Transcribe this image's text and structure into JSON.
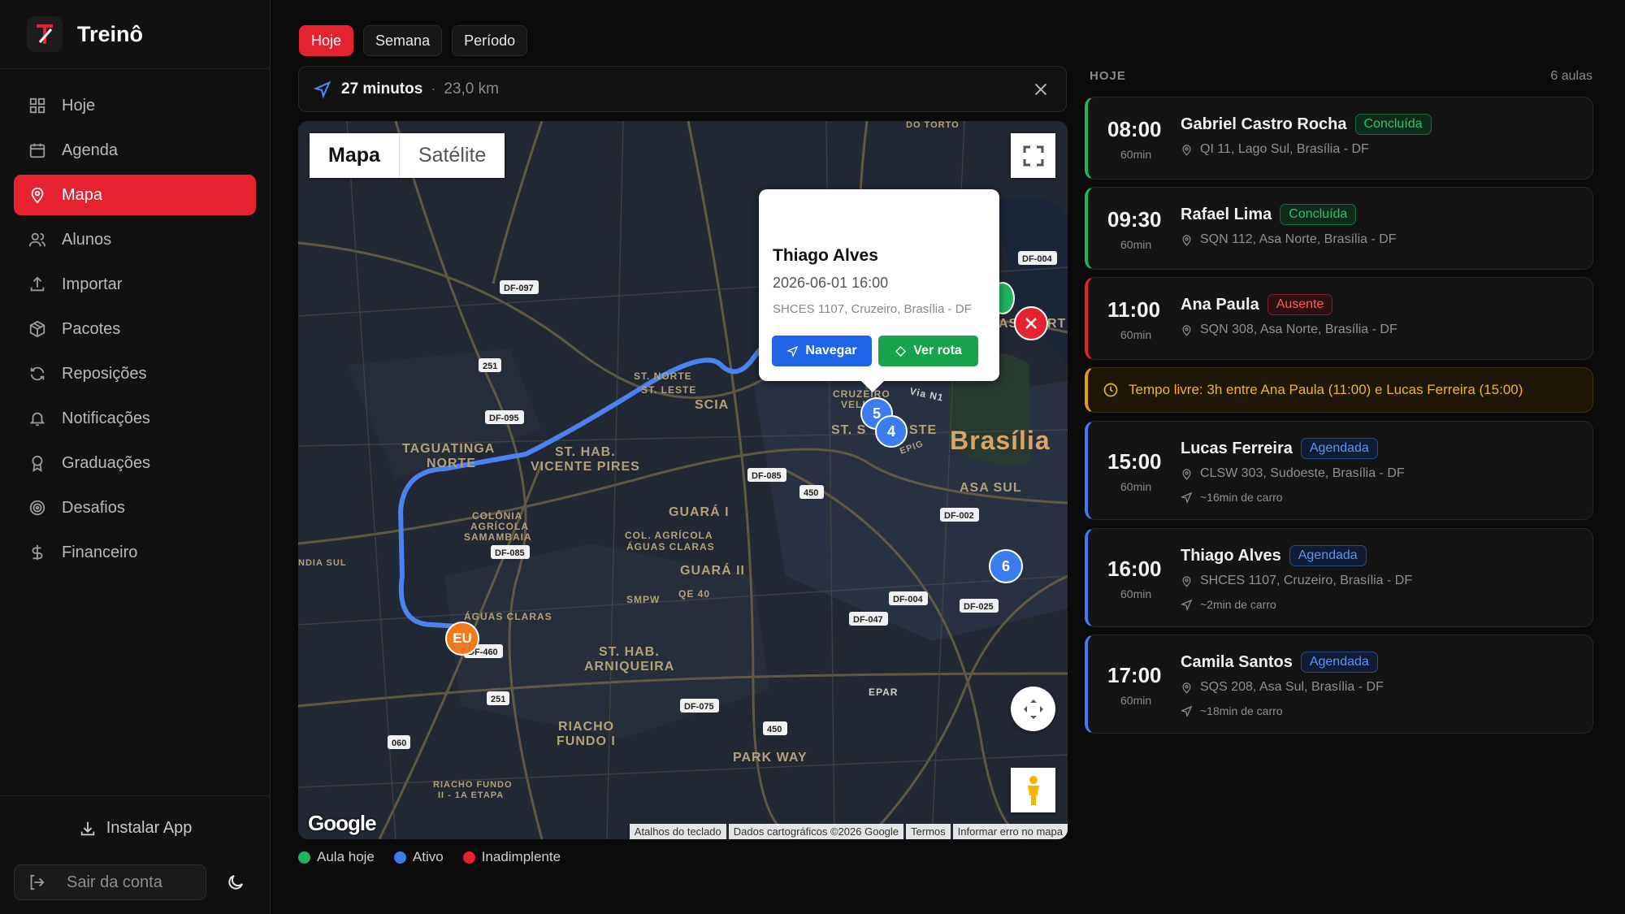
{
  "app": {
    "name": "Treinô"
  },
  "nav": {
    "items": [
      {
        "label": "Hoje",
        "icon": "grid-icon"
      },
      {
        "label": "Agenda",
        "icon": "calendar-icon"
      },
      {
        "label": "Mapa",
        "icon": "map-pin-icon",
        "active": true
      },
      {
        "label": "Alunos",
        "icon": "users-icon"
      },
      {
        "label": "Importar",
        "icon": "upload-icon"
      },
      {
        "label": "Pacotes",
        "icon": "package-icon"
      },
      {
        "label": "Reposições",
        "icon": "refresh-icon"
      },
      {
        "label": "Notificações",
        "icon": "bell-icon"
      },
      {
        "label": "Graduações",
        "icon": "award-icon"
      },
      {
        "label": "Desafios",
        "icon": "target-icon"
      },
      {
        "label": "Financeiro",
        "icon": "dollar-icon"
      }
    ],
    "install_label": "Instalar App",
    "logout_label": "Sair da conta"
  },
  "tabs": [
    {
      "label": "Hoje",
      "active": true
    },
    {
      "label": "Semana"
    },
    {
      "label": "Período"
    }
  ],
  "route": {
    "duration": "27 minutos",
    "separator": "·",
    "distance": "23,0 km"
  },
  "map": {
    "type_map": "Mapa",
    "type_satellite": "Satélite",
    "popup": {
      "name": "Thiago Alves",
      "datetime": "2026-06-01 16:00",
      "address": "SHCES 1107, Cruzeiro, Brasília - DF",
      "navigate_label": "Navegar",
      "route_label": "Ver rota"
    },
    "markers": {
      "me": "EU",
      "m4": "4",
      "m5": "5",
      "m6": "6"
    },
    "labels": {
      "brasilia": "Brasília",
      "taguatinga1": "TAGUATINGA",
      "taguatinga2": "NORTE",
      "sthab1": "ST. HAB.",
      "sthab2": "VICENTE PIRES",
      "guara1": "GUARÁ I",
      "guara2": "GUARÁ II",
      "aguas": "ÁGUAS CLARAS",
      "arn1": "ST. HAB.",
      "arn2": "ARNIQUEIRA",
      "riacho1": "RIACHO",
      "riacho2": "FUNDO I",
      "park": "PARK WAY",
      "asasul": "ASA SUL",
      "scia": "SCIA",
      "stnorte": "ST. NORTE",
      "stleste": "ST. LESTE",
      "colonia1": "COLÔNIA",
      "colonia2": "AGRÍCOLA",
      "colonia3": "SAMAMBAIA",
      "colagr1": "COL. AGRÍCOLA",
      "colagr2": "ÁGUAS CLARAS",
      "smpw": "SMPW",
      "qe40": "QE 40",
      "cruzeiro1": "CRUZEIRO",
      "cruzeiro2": "VELHO",
      "stsud": "ST. S",
      "stsud2": "STE",
      "epig": "EPIG",
      "vian1": "Via N1",
      "dourto": "DO TORTO",
      "riachofundo21": "RIACHO FUNDO",
      "riachofundo22": "II - 1A ETAPA",
      "indiasul": "NDIA SUL",
      "epar": "EPAR",
      "asnorte": "AS",
      "asnorte2": "RT"
    },
    "roads": {
      "df097": "DF-097",
      "r251a": "251",
      "df095": "DF-095",
      "df085a": "DF-085",
      "df085b": "DF-085",
      "r450a": "450",
      "df002": "DF-002",
      "df004a": "DF-004",
      "df004b": "DF-004",
      "df025": "DF-025",
      "df047": "DF-047",
      "df460": "DF-460",
      "r251b": "251",
      "r060": "060",
      "df075": "DF-075",
      "r450b": "450"
    },
    "attribution": [
      "Atalhos do teclado",
      "Dados cartográficos ©2026 Google",
      "Termos",
      "Informar erro no mapa"
    ],
    "google": "Google"
  },
  "legend": [
    {
      "label": "Aula hoje",
      "color": "#22b35e"
    },
    {
      "label": "Ativo",
      "color": "#3b7cf0"
    },
    {
      "label": "Inadimplente",
      "color": "#e5222f"
    }
  ],
  "list": {
    "title": "HOJE",
    "count": "6 aulas",
    "classes": [
      {
        "time": "08:00",
        "duration": "60min",
        "name": "Gabriel Castro Rocha",
        "status": "Concluída",
        "address": "QI 11, Lago Sul, Brasília - DF"
      },
      {
        "time": "09:30",
        "duration": "60min",
        "name": "Rafael Lima",
        "status": "Concluída",
        "address": "SQN 112, Asa Norte, Brasília - DF"
      },
      {
        "time": "11:00",
        "duration": "60min",
        "name": "Ana Paula",
        "status": "Ausente",
        "address": "SQN 308, Asa Norte, Brasília - DF"
      },
      {
        "time": "15:00",
        "duration": "60min",
        "name": "Lucas Ferreira",
        "status": "Agendada",
        "address": "CLSW 303, Sudoeste, Brasília - DF",
        "eta": "~16min de carro"
      },
      {
        "time": "16:00",
        "duration": "60min",
        "name": "Thiago Alves",
        "status": "Agendada",
        "address": "SHCES 1107, Cruzeiro, Brasília - DF",
        "eta": "~2min de carro"
      },
      {
        "time": "17:00",
        "duration": "60min",
        "name": "Camila Santos",
        "status": "Agendada",
        "address": "SQS 208, Asa Sul, Brasília - DF",
        "eta": "~18min de carro"
      }
    ],
    "free_time": "Tempo livre: 3h entre Ana Paula (11:00) e Lucas Ferreira (15:00)"
  },
  "colors": {
    "accent": "#e5222f",
    "done": "#22b35e",
    "absent": "#e5222f",
    "scheduled": "#3b7cf0",
    "free": "#d9a014"
  }
}
